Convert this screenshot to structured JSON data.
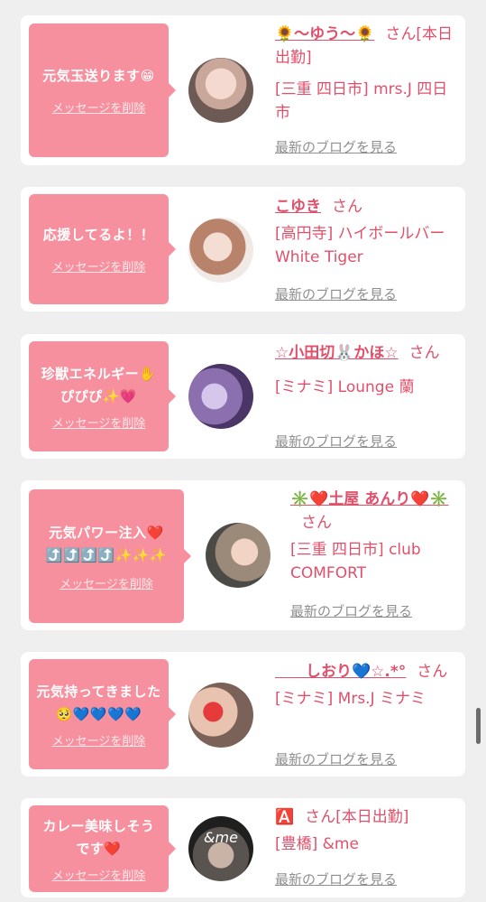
{
  "cards": [
    {
      "message": "元気玉送ります😁",
      "delete_label": "メッセージを削除",
      "name": "🌻〜ゆう〜🌻",
      "honorific": "さん",
      "status": "[本日出勤]",
      "shop": "[三重 四日市] mrs.J 四日市",
      "blog_label": "最新のブログを見る"
    },
    {
      "message": "応援してるよ！！",
      "delete_label": "メッセージを削除",
      "name": "こゆき",
      "honorific": "さん",
      "status": "",
      "shop": "[高円寺] ハイボールバー White Tiger",
      "blog_label": "最新のブログを見る"
    },
    {
      "message": "珍獣エネルギー✋ぴぴぴ✨💗",
      "delete_label": "メッセージを削除",
      "name": "☆小田切🐰かほ☆",
      "honorific": "さん",
      "status": "",
      "shop": "[ミナミ] Lounge 蘭",
      "blog_label": "最新のブログを見る"
    },
    {
      "message": "元気パワー注入❤️⤴️⤴️⤴️⤴️✨✨✨",
      "delete_label": "メッセージを削除",
      "name": "✳️❤️土屋 あんり❤️✳️",
      "honorific": "さん",
      "status": "",
      "shop": "[三重 四日市] club COMFORT",
      "blog_label": "最新のブログを見る"
    },
    {
      "message": "元気持ってきました🥺💙💙💙💙",
      "delete_label": "メッセージを削除",
      "name": "　　しおり💙☆.*°",
      "honorific": "さん",
      "status": "",
      "shop": "[ミナミ] Mrs.J ミナミ",
      "blog_label": "最新のブログを見る"
    },
    {
      "message": "カレー美味しそうです❤️",
      "delete_label": "メッセージを削除",
      "name": "🅰️",
      "honorific": "さん",
      "status": "[本日出勤]",
      "shop": "[豊橋] &me",
      "blog_label": "最新のブログを見る"
    }
  ],
  "avatar_text_6": "&me",
  "colors": {
    "bubble": "#f7909e",
    "name": "#e0506a",
    "link": "#8f8f8f"
  }
}
